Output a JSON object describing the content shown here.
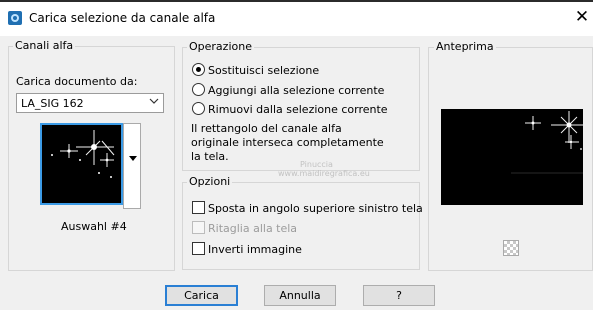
{
  "window": {
    "title": "Carica selezione da canale alfa",
    "close_symbol": "✕"
  },
  "canali": {
    "legend": "Canali alfa",
    "carica_label": "Carica documento da:",
    "document_value": "LA_SIG 162",
    "thumbnail_caption": "Auswahl #4"
  },
  "operazione": {
    "legend": "Operazione",
    "options": [
      {
        "label": "Sostituisci selezione",
        "selected": true
      },
      {
        "label": "Aggiungi alla selezione corrente",
        "selected": false
      },
      {
        "label": "Rimuovi dalla selezione corrente",
        "selected": false
      }
    ],
    "info_lines": [
      "Il rettangolo del canale alfa",
      "originale interseca completamente",
      "la tela."
    ]
  },
  "opzioni": {
    "legend": "Opzioni",
    "checks": [
      {
        "label": "Sposta in angolo superiore sinistro tela",
        "checked": false,
        "enabled": true
      },
      {
        "label": "Ritaglia alla tela",
        "checked": false,
        "enabled": false
      },
      {
        "label": "Inverti immagine",
        "checked": false,
        "enabled": true
      }
    ]
  },
  "anteprima": {
    "legend": "Anteprima"
  },
  "watermark": {
    "line1": "Pinuccia",
    "line2": "www.maidiregrafica.eu"
  },
  "buttons": {
    "ok": "Carica",
    "cancel": "Annulla",
    "help": "?"
  },
  "colors": {
    "focus_blue": "#3c9be6",
    "default_button_border": "#2a7fd4"
  },
  "icons": {
    "app": "app-icon",
    "close": "close-icon",
    "dropdown": "chevron-down-icon",
    "transparency": "checkerboard-icon"
  }
}
